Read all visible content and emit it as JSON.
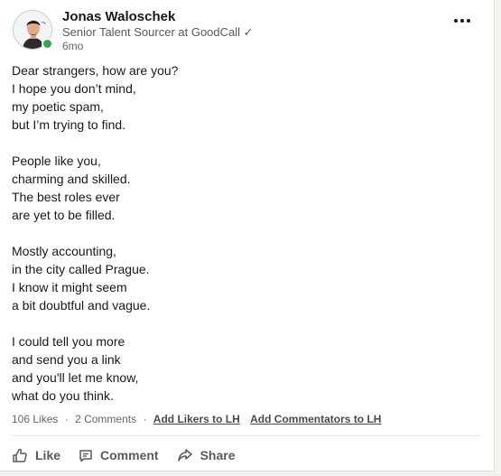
{
  "post": {
    "author": {
      "name": "Jonas Waloschek",
      "headline": "Senior Talent Sourcer at GoodCall ✓",
      "timestamp": "6mo",
      "online": true
    },
    "stanzas": [
      [
        "Dear strangers, how are you?",
        "I hope you don’t mind,",
        "my poetic spam,",
        "but I’m trying to find."
      ],
      [
        "People like you,",
        "charming and skilled.",
        "The best roles ever",
        "are yet to be filled."
      ],
      [
        "Mostly accounting,",
        "in the city called Prague.",
        "I know it might seem",
        "a bit doubtful and vague."
      ],
      [
        "I could tell you more",
        "and send you a link",
        "and you'll let me know,",
        "what do you think."
      ]
    ],
    "social": {
      "likes": "106 Likes",
      "separator": "·",
      "comments": "2 Comments",
      "add_likers": "Add Likers to LH",
      "add_commentators": "Add Commentators to LH"
    },
    "actions": {
      "like": "Like",
      "comment": "Comment",
      "share": "Share"
    }
  },
  "colors": {
    "presence": "#2fa84f",
    "text": "#191919",
    "muted": "#666666"
  }
}
